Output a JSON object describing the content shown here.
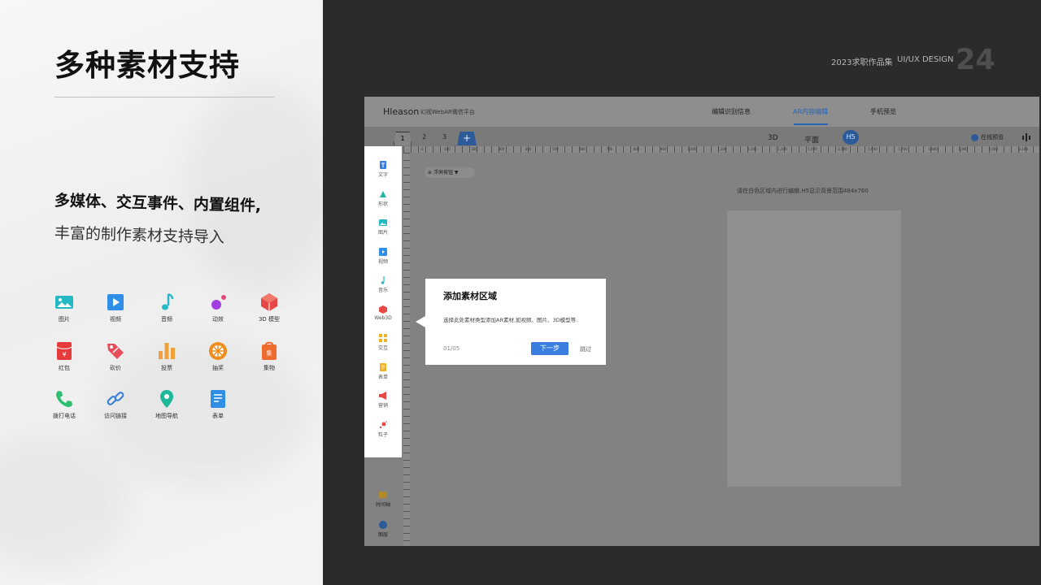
{
  "slide": {
    "title": "多种素材支持",
    "subtitle_line1": "多媒体、交互事件、内置组件,",
    "subtitle_line2": "丰富的制作素材支持导入",
    "portfolio_label": "2023求职作品集",
    "design_label": "UI/UX DESIGN",
    "page_number": "24"
  },
  "material_grid": [
    {
      "label": "图片",
      "icon": "image-icon",
      "color": "#25b9c6"
    },
    {
      "label": "视频",
      "icon": "video-icon",
      "color": "#2f8fe6"
    },
    {
      "label": "音频",
      "icon": "music-note-icon",
      "color": "#26b7c9"
    },
    {
      "label": "动效",
      "icon": "motion-icon",
      "color": "#a23fe0"
    },
    {
      "label": "3D 模型",
      "icon": "cube-3d-icon",
      "color": "#e64848"
    },
    {
      "label": "红包",
      "icon": "red-packet-icon",
      "color": "#e63b3b"
    },
    {
      "label": "砍价",
      "icon": "price-tag-icon",
      "color": "#e84d5a"
    },
    {
      "label": "投票",
      "icon": "vote-bars-icon",
      "color": "#f0a13a"
    },
    {
      "label": "抽奖",
      "icon": "lottery-wheel-icon",
      "color": "#f08c1e"
    },
    {
      "label": "集物",
      "icon": "collect-bag-icon",
      "color": "#ef6a2f"
    },
    {
      "label": "拨打电话",
      "icon": "phone-icon",
      "color": "#2fbf71"
    },
    {
      "label": "访问链接",
      "icon": "link-icon",
      "color": "#3b7fd6"
    },
    {
      "label": "地图导航",
      "icon": "map-pin-icon",
      "color": "#20b89a"
    },
    {
      "label": "表单",
      "icon": "form-icon",
      "color": "#2f8fe6"
    }
  ],
  "editor": {
    "brand": "Hleason",
    "brand_sub": "幻视WebAR微信平台",
    "nav": [
      "编辑识别信息",
      "AR内容编辑",
      "手机预览"
    ],
    "page_tabs": [
      "1",
      "2",
      "3"
    ],
    "add_tab": "+",
    "modes": [
      "3D",
      "平面",
      "H5"
    ],
    "preview_label": "在线预览",
    "ruler_numbers": [
      "0",
      "100",
      "200",
      "300",
      "400",
      "500",
      "600",
      "700",
      "800",
      "900",
      "1,000",
      "1,100",
      "1,200",
      "1,300",
      "1,400",
      "1,500",
      "1,600",
      "1,700",
      "1,800",
      "1,900",
      "2,000",
      "2,100"
    ],
    "dropdown_label": "浮屏按钮",
    "hint": "请在白色区域内进行编辑,H5显示背景范围484x760",
    "sidebar": [
      {
        "label": "文字",
        "icon": "text-icon",
        "color": "#3a7fe0"
      },
      {
        "label": "形状",
        "icon": "shape-icon",
        "color": "#26b7a8"
      },
      {
        "label": "图片",
        "icon": "image-icon",
        "color": "#25b9c6"
      },
      {
        "label": "视频",
        "icon": "video-icon",
        "color": "#2f8fe6"
      },
      {
        "label": "音乐",
        "icon": "music-note-icon",
        "color": "#26b7c9"
      },
      {
        "label": "Web3D",
        "icon": "cube-3d-icon",
        "color": "#e64848"
      },
      {
        "label": "交互",
        "icon": "interact-icon",
        "color": "#f0b21e"
      },
      {
        "label": "表单",
        "icon": "form-icon",
        "color": "#f0b21e"
      },
      {
        "label": "营销",
        "icon": "megaphone-icon",
        "color": "#e64848"
      },
      {
        "label": "粒子",
        "icon": "particle-icon",
        "color": "#e64848"
      }
    ],
    "lower_tools": [
      {
        "label": "时间轴",
        "icon": "timeline-icon"
      },
      {
        "label": "图层",
        "icon": "layers-icon"
      }
    ],
    "popover": {
      "title": "添加素材区域",
      "description": "选择此处素材类型添加AR素材,如视频、图片、3D模型等.",
      "step": "01/05",
      "next": "下一步",
      "skip": "跳过"
    }
  }
}
